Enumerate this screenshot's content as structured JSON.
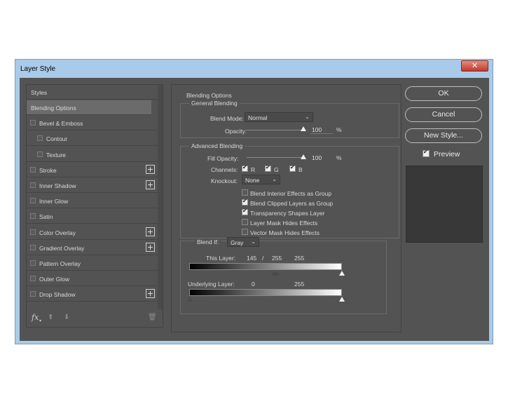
{
  "window": {
    "title": "Layer Style",
    "close": "✕"
  },
  "left_panel": {
    "styles_header": "Styles",
    "items": [
      {
        "label": "Blending Options",
        "has_checkbox": false,
        "has_plus": false,
        "active": true
      },
      {
        "label": "Bevel & Emboss",
        "has_checkbox": true,
        "has_plus": false
      },
      {
        "label": "Contour",
        "has_checkbox": true,
        "has_plus": false,
        "indent": true
      },
      {
        "label": "Texture",
        "has_checkbox": true,
        "has_plus": false,
        "indent": true
      },
      {
        "label": "Stroke",
        "has_checkbox": true,
        "has_plus": true
      },
      {
        "label": "Inner Shadow",
        "has_checkbox": true,
        "has_plus": true
      },
      {
        "label": "Inner Glow",
        "has_checkbox": true,
        "has_plus": false
      },
      {
        "label": "Satin",
        "has_checkbox": true,
        "has_plus": false
      },
      {
        "label": "Color Overlay",
        "has_checkbox": true,
        "has_plus": true
      },
      {
        "label": "Gradient Overlay",
        "has_checkbox": true,
        "has_plus": true
      },
      {
        "label": "Pattern Overlay",
        "has_checkbox": true,
        "has_plus": false
      },
      {
        "label": "Outer Glow",
        "has_checkbox": true,
        "has_plus": false
      },
      {
        "label": "Drop Shadow",
        "has_checkbox": true,
        "has_plus": true
      }
    ],
    "footer": {
      "fx": "fx",
      "up": "⬆",
      "down": "⬇",
      "trash": "🗑"
    }
  },
  "blending": {
    "title": "Blending Options",
    "general": {
      "title": "General Blending",
      "blend_mode_label": "Blend Mode:",
      "blend_mode_value": "Normal",
      "opacity_label": "Opacity:",
      "opacity_value": "100",
      "opacity_unit": "%"
    },
    "advanced": {
      "title": "Advanced Blending",
      "fill_opacity_label": "Fill Opacity:",
      "fill_opacity_value": "100",
      "fill_opacity_unit": "%",
      "channels_label": "Channels:",
      "channels": [
        {
          "label": "R",
          "checked": true
        },
        {
          "label": "G",
          "checked": true
        },
        {
          "label": "B",
          "checked": true
        }
      ],
      "knockout_label": "Knockout:",
      "knockout_value": "None",
      "options": [
        {
          "label": "Blend Interior Effects as Group",
          "checked": false
        },
        {
          "label": "Blend Clipped Layers as Group",
          "checked": true
        },
        {
          "label": "Transparency Shapes Layer",
          "checked": true
        },
        {
          "label": "Layer Mask Hides Effects",
          "checked": false
        },
        {
          "label": "Vector Mask Hides Effects",
          "checked": false
        }
      ]
    },
    "blend_if": {
      "label": "Blend If:",
      "value": "Gray",
      "this_layer_label": "This Layer:",
      "this_layer_low": "145",
      "this_layer_sep": "/",
      "this_layer_mid": "255",
      "this_layer_high": "255",
      "underlying_label": "Underlying Layer:",
      "underlying_low": "0",
      "underlying_high": "255"
    }
  },
  "buttons": {
    "ok": "OK",
    "cancel": "Cancel",
    "new_style": "New Style...",
    "preview_label": "Preview",
    "preview_checked": true
  }
}
